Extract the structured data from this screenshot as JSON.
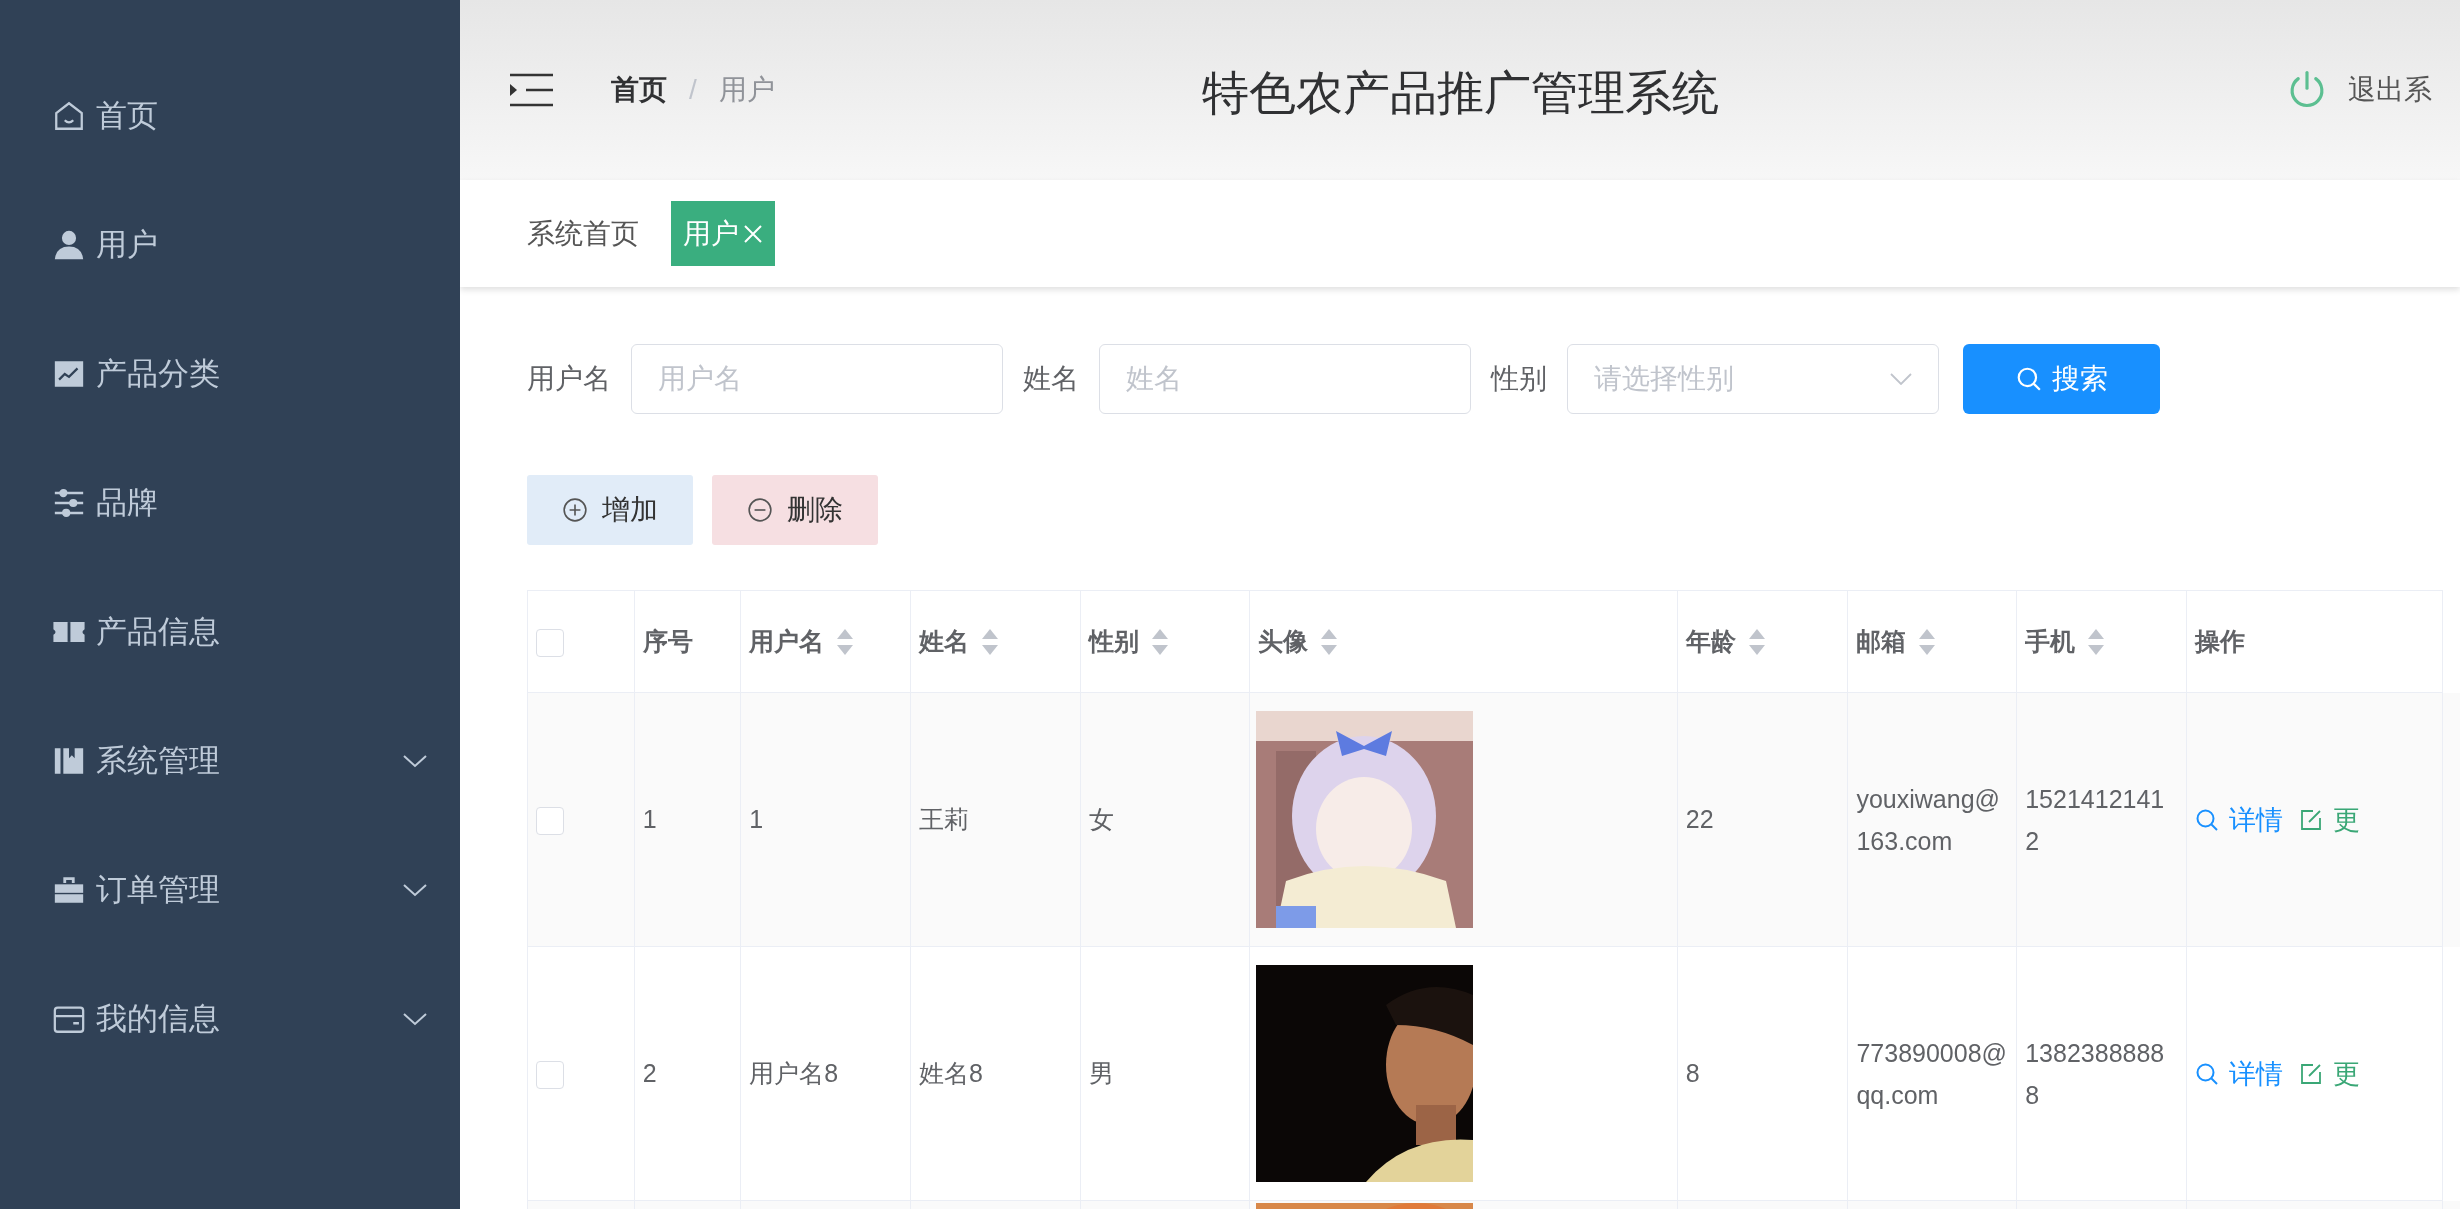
{
  "sidebar": {
    "items": [
      {
        "label": "首页",
        "has_children": false
      },
      {
        "label": "用户",
        "has_children": false
      },
      {
        "label": "产品分类",
        "has_children": false
      },
      {
        "label": "品牌",
        "has_children": false
      },
      {
        "label": "产品信息",
        "has_children": false
      },
      {
        "label": "系统管理",
        "has_children": true
      },
      {
        "label": "订单管理",
        "has_children": true
      },
      {
        "label": "我的信息",
        "has_children": true
      }
    ]
  },
  "header": {
    "breadcrumb": [
      {
        "label": "首页",
        "current": false
      },
      {
        "label": "用户",
        "current": true
      }
    ],
    "separator": "/",
    "title": "特色农产品推广管理系统",
    "logout": "退出系"
  },
  "tags": [
    {
      "label": "系统首页",
      "selected": false,
      "closable": false
    },
    {
      "label": "用户",
      "selected": true,
      "closable": true
    }
  ],
  "filters": [
    {
      "label": "用户名",
      "placeholder": "用户名",
      "kind": "input"
    },
    {
      "label": "姓名",
      "placeholder": "姓名",
      "kind": "input"
    },
    {
      "label": "性别",
      "placeholder": "请选择性别",
      "kind": "select"
    }
  ],
  "search_button": "搜索",
  "actions": [
    {
      "label": "增加",
      "kind": "add"
    },
    {
      "label": "删除",
      "kind": "delete"
    }
  ],
  "table": {
    "header_checked": false,
    "columns": [
      {
        "label": "序号",
        "sortable": false
      },
      {
        "label": "用户名",
        "sortable": true
      },
      {
        "label": "姓名",
        "sortable": true
      },
      {
        "label": "性别",
        "sortable": true
      },
      {
        "label": "头像",
        "sortable": true
      },
      {
        "label": "年龄",
        "sortable": true
      },
      {
        "label": "邮箱",
        "sortable": true
      },
      {
        "label": "手机",
        "sortable": true
      },
      {
        "label": "操作",
        "sortable": false
      }
    ],
    "rows": [
      {
        "checked": false,
        "index": "1",
        "username": "1",
        "name": "王莉",
        "gender": "女",
        "avatar": {
          "kind": "picture"
        },
        "age": "22",
        "email": "youxiwang@163.com",
        "phone": "15214121412",
        "actions": [
          {
            "label": "详情",
            "kind": "detail"
          },
          {
            "label": "更",
            "kind": "edit"
          }
        ]
      },
      {
        "checked": false,
        "index": "2",
        "username": "用户名8",
        "name": "姓名8",
        "gender": "男",
        "avatar": {
          "kind": "picture"
        },
        "age": "8",
        "email": "773890008@qq.com",
        "phone": "13823888888",
        "actions": [
          {
            "label": "详情",
            "kind": "detail"
          },
          {
            "label": "更",
            "kind": "edit"
          }
        ]
      },
      {
        "avatar": {
          "kind": "picture"
        }
      }
    ]
  }
}
